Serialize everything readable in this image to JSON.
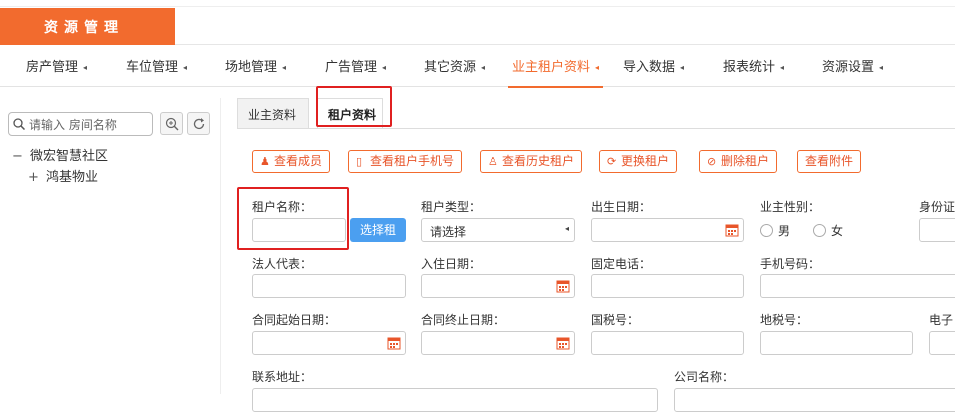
{
  "app": {
    "title": "资源管理"
  },
  "menu": [
    {
      "label": "房产管理"
    },
    {
      "label": "车位管理"
    },
    {
      "label": "场地管理"
    },
    {
      "label": "广告管理"
    },
    {
      "label": "其它资源"
    },
    {
      "label": "业主租户资料"
    },
    {
      "label": "导入数据"
    },
    {
      "label": "报表统计"
    },
    {
      "label": "资源设置"
    }
  ],
  "sidebar": {
    "search_placeholder": "请输入 房间名称",
    "tree": [
      {
        "toggle": "−",
        "label": "微宏智慧社区"
      },
      {
        "toggle": "+",
        "label": "鸿基物业"
      }
    ]
  },
  "tabs": [
    {
      "label": "业主资料",
      "active": false
    },
    {
      "label": "租户资料",
      "active": true
    }
  ],
  "actions": [
    {
      "label": "查看成员",
      "icon": "user-icon"
    },
    {
      "label": "查看租户手机号",
      "icon": "phone-icon"
    },
    {
      "label": "查看历史租户",
      "icon": "history-user-icon"
    },
    {
      "label": "更换租户",
      "icon": "swap-icon"
    },
    {
      "label": "删除租户",
      "icon": "delete-icon"
    },
    {
      "label": "查看附件",
      "icon": ""
    }
  ],
  "form": {
    "tenant_name_label": "租户名称：",
    "select_tenant_button": "选择租",
    "tenant_type_label": "租户类型：",
    "tenant_type_value": "请选择",
    "birth_date_label": "出生日期：",
    "gender_label": "业主性别：",
    "gender_options": [
      "男",
      "女"
    ],
    "id_label_partial": "身份证",
    "legal_rep_label": "法人代表：",
    "checkin_date_label": "入住日期：",
    "fixed_phone_label": "固定电话：",
    "mobile_label": "手机号码：",
    "contract_start_label": "合同起始日期：",
    "contract_end_label": "合同终止日期：",
    "national_tax_label": "国税号：",
    "local_tax_label": "地税号：",
    "email_label_partial": "电子",
    "address_label": "联系地址：",
    "company_label": "公司名称："
  },
  "colors": {
    "brand": "#f26b2e",
    "primary_button": "#4b9ff0",
    "highlight_box": "#e02020"
  }
}
